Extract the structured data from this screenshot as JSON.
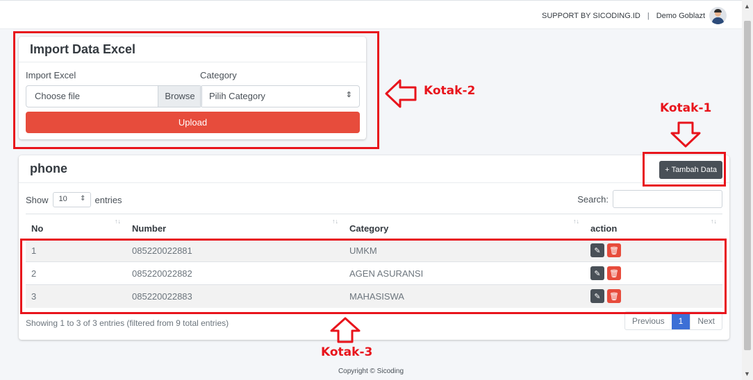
{
  "topbar": {
    "support_text": "SUPPORT BY SICODING.ID",
    "separator": "|",
    "user_name": "Demo Goblazt"
  },
  "import_card": {
    "title": "Import Data Excel",
    "file_label": "Import Excel",
    "file_placeholder": "Choose file",
    "browse_label": "Browse",
    "category_label": "Category",
    "category_selected": "Pilih Category",
    "upload_label": "Upload"
  },
  "phone_card": {
    "title": "phone",
    "add_button": "+ Tambah Data",
    "show_label": "Show",
    "entries_value": "10",
    "entries_label": "entries",
    "search_label": "Search:",
    "columns": [
      "No",
      "Number",
      "Category",
      "action"
    ],
    "rows": [
      {
        "no": "1",
        "number": "085220022881",
        "category": "UMKM"
      },
      {
        "no": "2",
        "number": "085220022882",
        "category": "AGEN ASURANSI"
      },
      {
        "no": "3",
        "number": "085220022883",
        "category": "MAHASISWA"
      }
    ],
    "info": "Showing 1 to 3 of 3 entries (filtered from 9 total entries)",
    "pagination": {
      "previous": "Previous",
      "current": "1",
      "next": "Next"
    }
  },
  "footer": {
    "copyright": "Copyright © Sicoding"
  },
  "annotations": {
    "kotak1": "Kotak-1",
    "kotak2": "Kotak-2",
    "kotak3": "Kotak-3",
    "color": "#e8141c"
  },
  "colors": {
    "danger": "#e74c3c",
    "dark": "#495057",
    "primary": "#3c6fd6"
  }
}
